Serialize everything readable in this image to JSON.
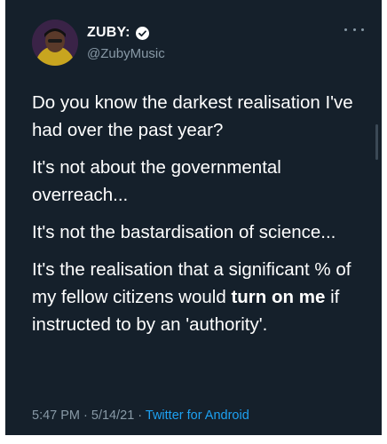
{
  "tweet": {
    "author": {
      "display_name": "ZUBY:",
      "handle": "@ZubyMusic",
      "verified": true,
      "avatar_icon": "profile-avatar"
    },
    "paragraphs": [
      [
        "Do you know the darkest realisation I've had over the past year?"
      ],
      [
        "It's not about the governmental overreach..."
      ],
      [
        "It's not the bastardisation of science..."
      ],
      [
        "It's the realisation that a significant % of my fellow citizens would ",
        "turn on me",
        " if instructed to by an 'authority'."
      ]
    ],
    "meta": {
      "time": "5:47 PM",
      "sep1": " · ",
      "date": "5/14/21",
      "sep2": " · ",
      "source": "Twitter for Android"
    },
    "more_icon": "more-options-icon"
  },
  "colors": {
    "background": "#15202b",
    "text": "#ffffff",
    "muted": "#8899a6",
    "link": "#1da1f2"
  }
}
